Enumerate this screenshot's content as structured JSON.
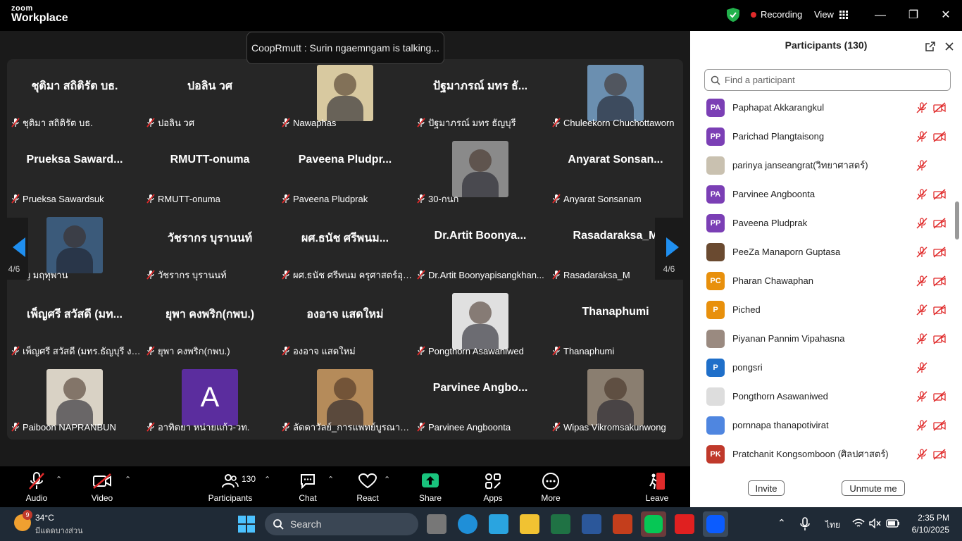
{
  "app": {
    "brand_top": "zoom",
    "brand_bottom": "Workplace",
    "recording": "Recording",
    "view": "View"
  },
  "toast": "CoopRmutt : Surin ngaemngam is talking...",
  "stage": {
    "page_left": "4/6",
    "page_right": "4/6",
    "tiles": [
      {
        "big": "ชุติมา  สถิติรัต บธ.",
        "name": "ชุติมา  สถิติรัต บธ."
      },
      {
        "big": "ปอลิน วศ",
        "name": "ปอลิน วศ"
      },
      {
        "video": true,
        "name": "Nawaphas",
        "bg": "#d8c9a0"
      },
      {
        "big": "ปัฐมาภรณ์ มทร ธั...",
        "name": "ปัฐมาภรณ์ มทร ธัญบุรี"
      },
      {
        "video": true,
        "name": "Chuleekorn Chuchottaworn",
        "bg": "#6b8fb0"
      },
      {
        "big": "Prueksa  Saward...",
        "name": "Prueksa Sawardsuk"
      },
      {
        "big": "RMUTT-onuma",
        "name": "RMUTT-onuma"
      },
      {
        "big": "Paveena  Pludpr...",
        "name": "Paveena  Pludprak"
      },
      {
        "video": true,
        "name": "30-กนก",
        "bg": "#8a8a8a"
      },
      {
        "big": "Anyarat  Sonsan...",
        "name": "Anyarat Sonsanam"
      },
      {
        "video": true,
        "name": "ญ  มฤทุพาน",
        "bg": "#3b5a7a"
      },
      {
        "big": "วัชรากร  บุรานนท์",
        "name": "วัชรากร  บุรานนท์"
      },
      {
        "big": "ผศ.ธนัช ศรีพนม...",
        "name": "ผศ.ธนัช ศรีพนม ครุศาสตร์อุตส..."
      },
      {
        "big": "Dr.Artit  Boonya...",
        "name": "Dr.Artit Boonyapisangkhan..."
      },
      {
        "big": "Rasadaraksa_M",
        "name": "Rasadaraksa_M"
      },
      {
        "big": "เพ็ญศรี สวัสดี (มท...",
        "name": "เพ็ญศรี สวัสดี (มทร.ธัญบุรี งาน..."
      },
      {
        "big": "ยุพา คงพริก(กพบ.)",
        "name": "ยุพา คงพริก(กพบ.)"
      },
      {
        "big": "องอาจ  แสดใหม่",
        "name": "องอาจ  แสดใหม่"
      },
      {
        "video": true,
        "name": "Pongthorn Asawaniwed",
        "bg": "#e0e0e0"
      },
      {
        "big": "Thanaphumi",
        "name": "Thanaphumi"
      },
      {
        "video": true,
        "name": "Paiboon NAPRANBUN",
        "bg": "#d9d2c5"
      },
      {
        "letter": "A",
        "name": "อาทิตยา หน่ายแก้ว-วท.",
        "bg": "#5b2d9e"
      },
      {
        "video": true,
        "name": "ลัดดาวัลย์_การแพทย์บูรณาการ ...",
        "bg": "#b58b5a"
      },
      {
        "big": "Parvinee  Angbo...",
        "name": "Parvinee Angboonta"
      },
      {
        "video": true,
        "name": "Wipas Vikromsakunwong",
        "bg": "#8a7e70"
      }
    ]
  },
  "toolbar": {
    "audio": "Audio",
    "video": "Video",
    "participants": "Participants",
    "participants_count": "130",
    "chat": "Chat",
    "react": "React",
    "share": "Share",
    "apps": "Apps",
    "more": "More",
    "leave": "Leave"
  },
  "panel": {
    "title": "Participants (130)",
    "search_placeholder": "Find a participant",
    "invite": "Invite",
    "unmute": "Unmute me",
    "participants": [
      {
        "initials": "PA",
        "name": "Paphapat Akkarangkul",
        "color": "#7b3fb5",
        "video_off": true
      },
      {
        "initials": "PP",
        "name": "Parichad Plangtaisong",
        "color": "#7b3fb5",
        "video_off": true
      },
      {
        "initials": "",
        "name": "parinya janseangrat(วิทยาศาสตร์)",
        "color": "#c9c1b0",
        "video_off": false
      },
      {
        "initials": "PA",
        "name": "Parvinee Angboonta",
        "color": "#7b3fb5",
        "video_off": true
      },
      {
        "initials": "PP",
        "name": "Paveena  Pludprak",
        "color": "#7b3fb5",
        "video_off": true
      },
      {
        "initials": "",
        "name": "PeeZa Manaporn Guptasa",
        "color": "#6a4a30",
        "video_off": true
      },
      {
        "initials": "PC",
        "name": "Pharan Chawaphan",
        "color": "#e8900c",
        "video_off": true
      },
      {
        "initials": "P",
        "name": "Piched",
        "color": "#e8900c",
        "video_off": true
      },
      {
        "initials": "",
        "name": "Piyanan Pannim Vipahasna",
        "color": "#9a8a80",
        "video_off": true
      },
      {
        "initials": "P",
        "name": "pongsri",
        "color": "#1f6fc9",
        "video_off": false
      },
      {
        "initials": "",
        "name": "Pongthorn Asawaniwed",
        "color": "#dddddd",
        "video_off": true
      },
      {
        "initials": "",
        "name": "pornnapa thanapotivirat",
        "color": "#4f86e0",
        "video_off": true
      },
      {
        "initials": "PK",
        "name": "Pratchanit Kongsomboon (ศิลปศาสตร์)",
        "color": "#c0392b",
        "video_off": true
      }
    ]
  },
  "taskbar": {
    "temp": "34°C",
    "weather": "มีแดดบางส่วน",
    "badge": "9",
    "search": "Search",
    "lang": "ไทย",
    "time": "2:35 PM",
    "date": "6/10/2025"
  }
}
